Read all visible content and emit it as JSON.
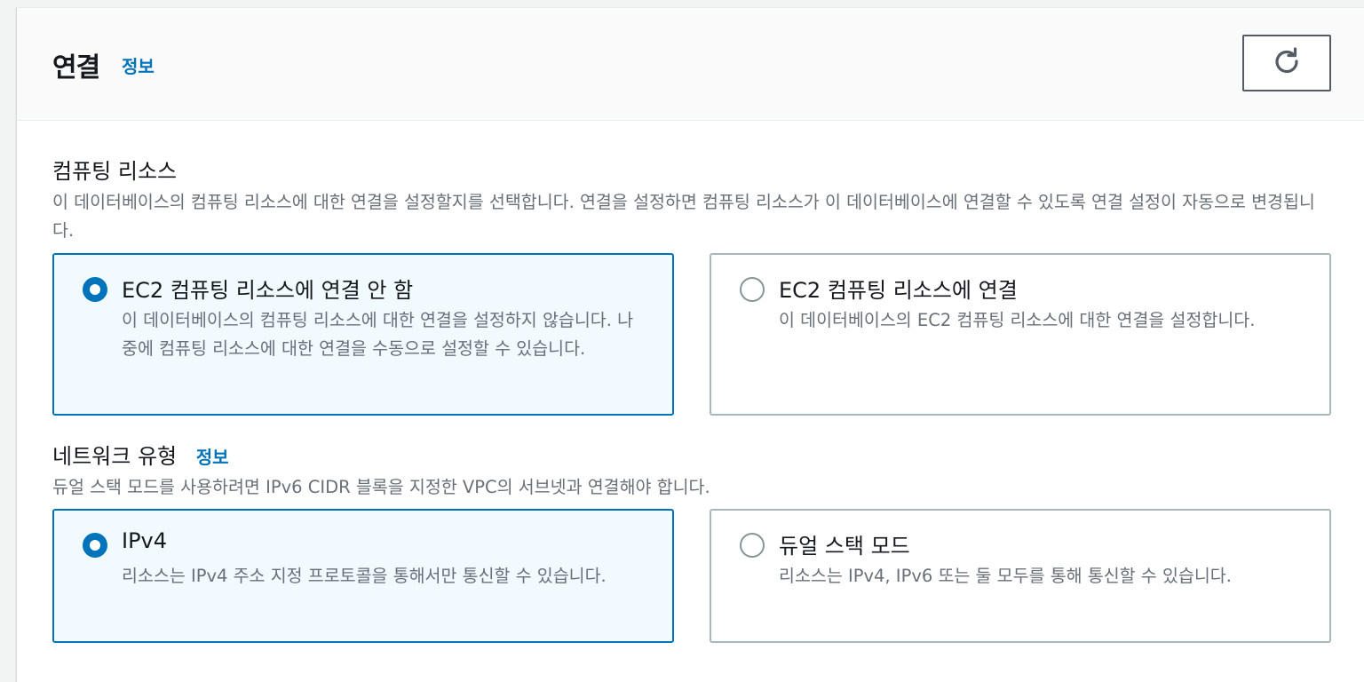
{
  "panel": {
    "title": "연결",
    "info_label": "정보",
    "refresh_icon": "refresh-icon"
  },
  "compute": {
    "label": "컴퓨팅 리소스",
    "description": "이 데이터베이스의 컴퓨팅 리소스에 대한 연결을 설정할지를 선택합니다. 연결을 설정하면 컴퓨팅 리소스가 이 데이터베이스에 연결할 수 있도록 연결 설정이 자동으로 변경됩니다.",
    "options": [
      {
        "title": "EC2 컴퓨팅 리소스에 연결 안 함",
        "description": "이 데이터베이스의 컴퓨팅 리소스에 대한 연결을 설정하지 않습니다. 나중에 컴퓨팅 리소스에 대한 연결을 수동으로 설정할 수 있습니다.",
        "selected": true
      },
      {
        "title": "EC2 컴퓨팅 리소스에 연결",
        "description": "이 데이터베이스의 EC2 컴퓨팅 리소스에 대한 연결을 설정합니다.",
        "selected": false
      }
    ]
  },
  "network": {
    "label": "네트워크 유형",
    "info_label": "정보",
    "description": "듀얼 스택 모드를 사용하려면 IPv6 CIDR 블록을 지정한 VPC의 서브넷과 연결해야 합니다.",
    "options": [
      {
        "title": "IPv4",
        "description": "리소스는 IPv4 주소 지정 프로토콜을 통해서만 통신할 수 있습니다.",
        "selected": true
      },
      {
        "title": "듀얼 스택 모드",
        "description": "리소스는 IPv4, IPv6 또는 둘 모두를 통해 통신할 수 있습니다.",
        "selected": false
      }
    ]
  },
  "colors": {
    "accent": "#0073bb",
    "selected_bg": "#f1faff",
    "border": "#aab7b8",
    "muted_text": "#687078"
  }
}
